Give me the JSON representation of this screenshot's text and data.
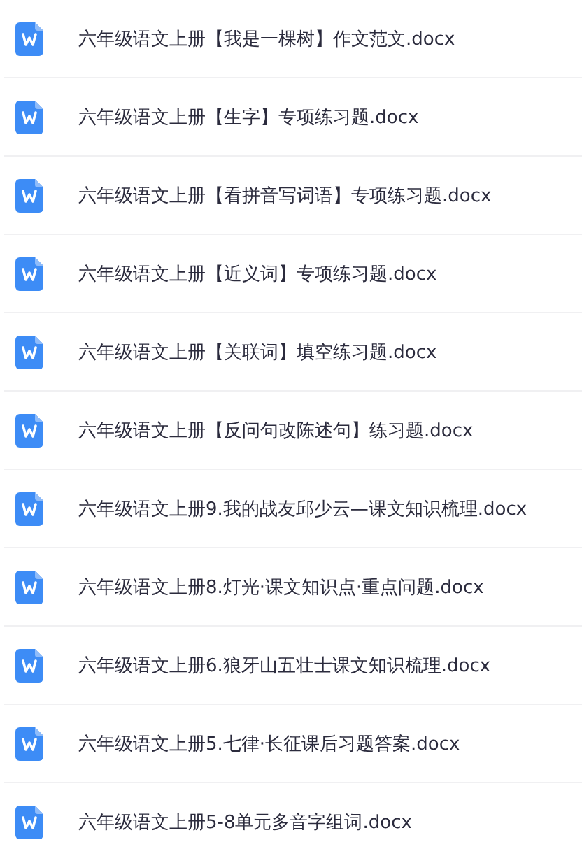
{
  "files": [
    {
      "name": "六年级语文上册【我是一棵树】作文范文.docx"
    },
    {
      "name": "六年级语文上册【生字】专项练习题.docx"
    },
    {
      "name": "六年级语文上册【看拼音写词语】专项练习题.docx"
    },
    {
      "name": "六年级语文上册【近义词】专项练习题.docx"
    },
    {
      "name": "六年级语文上册【关联词】填空练习题.docx"
    },
    {
      "name": "六年级语文上册【反问句改陈述句】练习题.docx"
    },
    {
      "name": "六年级语文上册9.我的战友邱少云—课文知识梳理.docx"
    },
    {
      "name": "六年级语文上册8.灯光·课文知识点·重点问题.docx"
    },
    {
      "name": "六年级语文上册6.狼牙山五壮士课文知识梳理.docx"
    },
    {
      "name": "六年级语文上册5.七律·长征课后习题答案.docx"
    },
    {
      "name": "六年级语文上册5-8单元多音字组词.docx"
    }
  ]
}
